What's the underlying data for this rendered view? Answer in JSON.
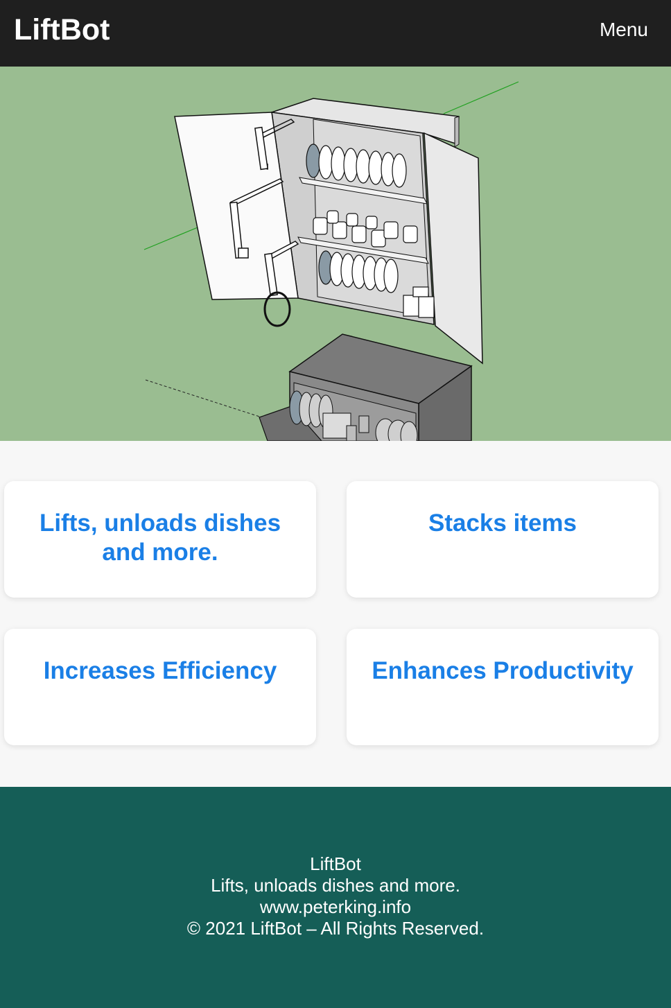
{
  "header": {
    "brand": "LiftBot",
    "menu_label": "Menu"
  },
  "hero": {
    "illustration": "3d-dish-lifting-cabinet-model",
    "background_color": "#9abd91"
  },
  "features": [
    {
      "title": "Lifts, unloads dishes and more."
    },
    {
      "title": "Stacks items"
    },
    {
      "title": "Increases Efficiency"
    },
    {
      "title": "Enhances Productivity"
    }
  ],
  "footer": {
    "brand": "LiftBot",
    "tagline": "Lifts, unloads dishes and more.",
    "website": "www.peterking.info",
    "copyright": "© 2021 LiftBot – All Rights Reserved."
  },
  "colors": {
    "header_bg": "#1f1f1f",
    "accent": "#1a7fe6",
    "footer_bg": "#155e57"
  }
}
